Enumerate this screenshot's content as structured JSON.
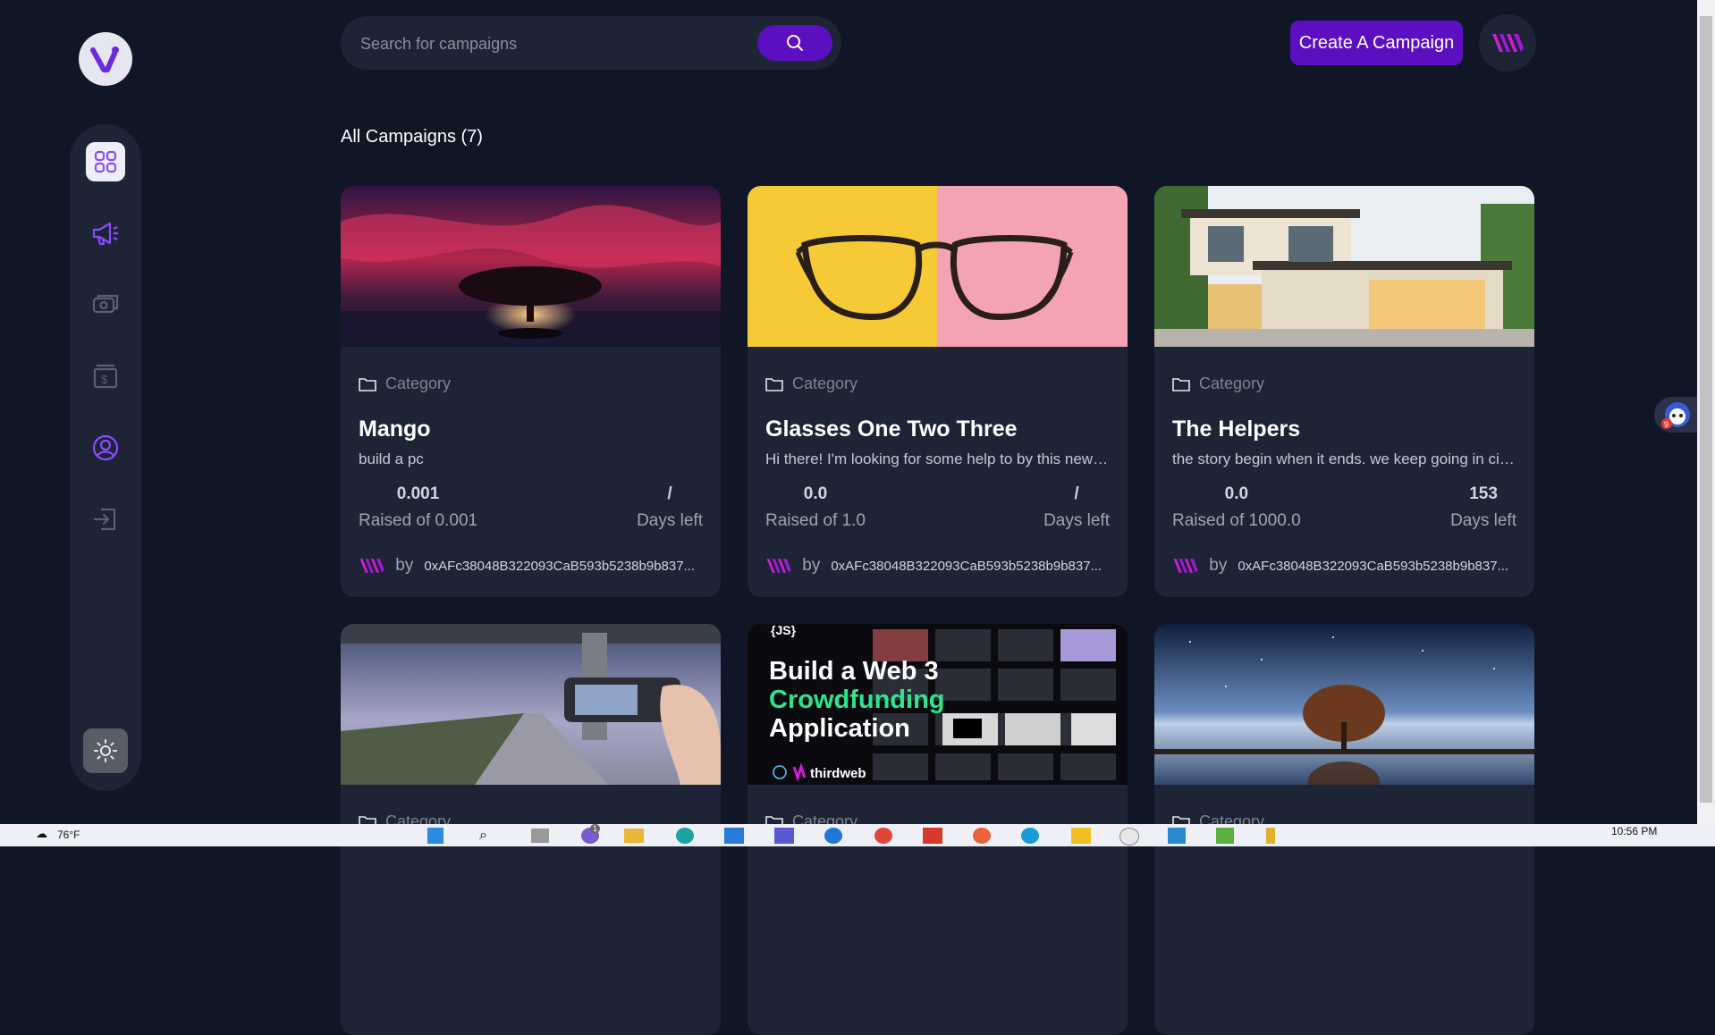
{
  "brand": {
    "logo_letter": "V"
  },
  "search": {
    "placeholder": "Search for campaigns"
  },
  "header": {
    "create_label": "Create A Campaign"
  },
  "main": {
    "heading": "All Campaigns (7)"
  },
  "sidebar": {
    "items": [
      {
        "name": "dashboard",
        "icon": "grid-icon",
        "active": true
      },
      {
        "name": "campaign",
        "icon": "megaphone-icon"
      },
      {
        "name": "payment",
        "icon": "cash-icon"
      },
      {
        "name": "withdraw",
        "icon": "voucher-icon"
      },
      {
        "name": "profile",
        "icon": "user-icon"
      },
      {
        "name": "logout",
        "icon": "logout-icon"
      }
    ],
    "theme_icon": "sun-icon"
  },
  "campaigns": [
    {
      "category": "Category",
      "title": "Mango",
      "description": "build a pc",
      "raised": "0.001",
      "raised_label": "Raised of 0.001",
      "days": "/",
      "days_label": "Days left",
      "by": "by",
      "owner": "0xAFc38048B322093CaB593b5238b9b837..."
    },
    {
      "category": "Category",
      "title": "Glasses One Two Three",
      "description": "Hi there! I'm looking for some help to by this new pair of glasses",
      "raised": "0.0",
      "raised_label": "Raised of 1.0",
      "days": "/",
      "days_label": "Days left",
      "by": "by",
      "owner": "0xAFc38048B322093CaB593b5238b9b837..."
    },
    {
      "category": "Category",
      "title": "The Helpers",
      "description": "the story begin when it ends. we keep going in circles",
      "raised": "0.0",
      "raised_label": "Raised of 1000.0",
      "days": "153",
      "days_label": "Days left",
      "by": "by",
      "owner": "0xAFc38048B322093CaB593b5238b9b837..."
    },
    {
      "category": "Category"
    },
    {
      "category": "Category",
      "thumb_lines": [
        "Build a Web 3",
        "Crowdfunding",
        "Application"
      ],
      "thumb_brand": "thirdweb",
      "thumb_tag": "{JS}"
    },
    {
      "category": "Category"
    }
  ],
  "taskbar": {
    "weather": "76°F",
    "time": "10:56 PM",
    "badge": "1"
  },
  "widget": {
    "badge": "9"
  },
  "colors": {
    "accent": "#5b0fc0",
    "bg": "#101626",
    "card": "#1c2436"
  }
}
